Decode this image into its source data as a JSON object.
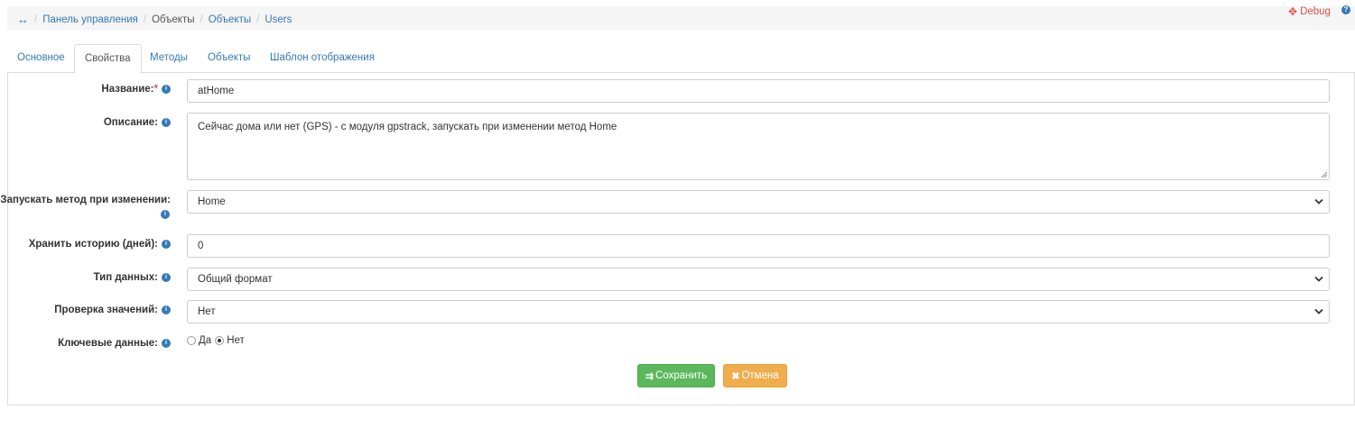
{
  "breadcrumb": {
    "home_icon": "horizontal-arrows-icon",
    "items": [
      {
        "label": "Панель управления",
        "link": true
      },
      {
        "label": "Объекты",
        "link": false
      },
      {
        "label": "Объекты",
        "link": true
      },
      {
        "label": "Users",
        "link": true
      }
    ]
  },
  "header": {
    "debug_label": "Debug",
    "debug_icon": "bug-icon",
    "help_icon": "question-circle-icon"
  },
  "tabs": [
    {
      "label": "Основное",
      "active": false
    },
    {
      "label": "Свойства",
      "active": true
    },
    {
      "label": "Методы",
      "active": false
    },
    {
      "label": "Объекты",
      "active": false
    },
    {
      "label": "Шаблон отображения",
      "active": false
    }
  ],
  "form": {
    "name": {
      "label": "Название:",
      "required_mark": "*",
      "value": "atHome"
    },
    "description": {
      "label": "Описание:",
      "value": "Сейчас дома или нет (GPS) - с модуля gpstrack, запускать при изменении метод Home"
    },
    "onchange_method": {
      "label": "Запускать метод при изменении:",
      "value": "Home"
    },
    "keep_history": {
      "label": "Хранить историю (дней):",
      "value": "0"
    },
    "data_type": {
      "label": "Тип данных:",
      "value": "Общий формат"
    },
    "validation": {
      "label": "Проверка значений:",
      "value": "Нет"
    },
    "key_data": {
      "label": "Ключевые данные:",
      "options": [
        {
          "label": "Да",
          "checked": false
        },
        {
          "label": "Нет",
          "checked": true
        }
      ]
    }
  },
  "buttons": {
    "save_label": "Сохранить",
    "cancel_label": "Отмена"
  },
  "colors": {
    "link": "#337ab7",
    "debug": "#d9534f",
    "save": "#5cb85c",
    "cancel": "#f0ad4e"
  }
}
